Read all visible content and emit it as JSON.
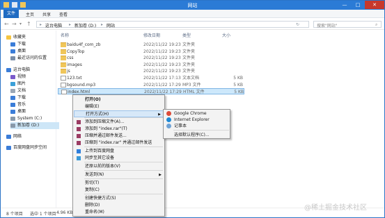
{
  "window": {
    "title": "网站"
  },
  "titlebar": {
    "minimize": "—",
    "maximize": "□",
    "close": "✕"
  },
  "ribbon": {
    "tabs": [
      "文件",
      "主页",
      "共享",
      "查看"
    ]
  },
  "address": {
    "crumbs": [
      "这台电脑",
      "新加卷 (D:)",
      "网站"
    ],
    "search_placeholder": "搜索\"网站\""
  },
  "sidebar": {
    "items": [
      {
        "label": "收藏夹",
        "icon": "star-icon",
        "color": "#f5c542"
      },
      {
        "label": "下载",
        "icon": "download-icon",
        "color": "#3b7dd8"
      },
      {
        "label": "桌面",
        "icon": "desktop-icon",
        "color": "#3b7dd8"
      },
      {
        "label": "最近访问的位置",
        "icon": "recent-icon",
        "color": "#7a8ea8"
      },
      {
        "label": "这台电脑",
        "icon": "computer-icon",
        "color": "#3b7dd8"
      },
      {
        "label": "视频",
        "icon": "video-icon",
        "color": "#7a5acb"
      },
      {
        "label": "图片",
        "icon": "picture-icon",
        "color": "#3ba0d8"
      },
      {
        "label": "文档",
        "icon": "document-icon",
        "color": "#9aa7b6"
      },
      {
        "label": "下载",
        "icon": "download-icon",
        "color": "#3b7dd8"
      },
      {
        "label": "音乐",
        "icon": "music-icon",
        "color": "#3b7dd8"
      },
      {
        "label": "桌面",
        "icon": "desktop-icon",
        "color": "#3b7dd8"
      },
      {
        "label": "System (C:)",
        "icon": "drive-icon",
        "color": "#8899aa"
      },
      {
        "label": "新加卷 (D:)",
        "icon": "drive-icon",
        "color": "#8899aa"
      },
      {
        "label": "网络",
        "icon": "network-icon",
        "color": "#3b7dd8"
      },
      {
        "label": "百度网盘同步空间",
        "icon": "cloud-icon",
        "color": "#3b7dd8"
      }
    ]
  },
  "columns": {
    "name": "名称",
    "date": "修改日期",
    "type": "类型",
    "size": "大小"
  },
  "files": [
    {
      "name": "baidu4f_com_zb",
      "date": "2022/11/22 19:23",
      "type": "文件夹",
      "size": "",
      "kind": "folder"
    },
    {
      "name": "CopyTop",
      "date": "2022/11/22 19:23",
      "type": "文件夹",
      "size": "",
      "kind": "folder"
    },
    {
      "name": "css",
      "date": "2022/11/22 19:23",
      "type": "文件夹",
      "size": "",
      "kind": "folder"
    },
    {
      "name": "images",
      "date": "2022/11/22 19:23",
      "type": "文件夹",
      "size": "",
      "kind": "folder"
    },
    {
      "name": "js",
      "date": "2022/11/22 19:23",
      "type": "文件夹",
      "size": "",
      "kind": "folder"
    },
    {
      "name": "123.txt",
      "date": "2022/11/22 17:13",
      "type": "文本文档",
      "size": "5 KB",
      "kind": "file"
    },
    {
      "name": "bgsound.mp3",
      "date": "2022/11/22 17:29",
      "type": "MP3 文件",
      "size": "5 KB",
      "kind": "file"
    },
    {
      "name": "index.html",
      "date": "2022/11/22 17:29",
      "type": "HTML 文件",
      "size": "5 KB",
      "kind": "file"
    }
  ],
  "status": {
    "count": "8 个项目",
    "selected": "选中 1 个项目",
    "size": "4.96 KB"
  },
  "context_menu": {
    "items": [
      {
        "label": "打开(O)",
        "bold": true
      },
      {
        "label": "编辑(E)"
      },
      {
        "label": "打开方式(H)",
        "submenu": true,
        "highlight": true
      },
      {
        "label": "添加到压缩文件(A)...",
        "icon": "winrar-icon"
      },
      {
        "label": "添加到 \"index.rar\"(T)",
        "icon": "winrar-icon"
      },
      {
        "label": "压缩并通过邮件发送...",
        "icon": "winrar-icon"
      },
      {
        "label": "压缩到 \"index.rar\" 并通过邮件发送",
        "icon": "winrar-icon"
      },
      {
        "label": "上传到百度网盘",
        "icon": "cloud-icon"
      },
      {
        "label": "同步至其它设备",
        "icon": "sync-icon"
      },
      {
        "label": "还原以前的版本(V)"
      },
      {
        "label": "发送到(N)",
        "submenu": true
      },
      {
        "label": "剪切(T)"
      },
      {
        "label": "复制(C)"
      },
      {
        "label": "创建快捷方式(S)"
      },
      {
        "label": "删除(D)"
      },
      {
        "label": "重命名(M)"
      }
    ]
  },
  "submenu": {
    "items": [
      {
        "label": "Google Chrome",
        "icon": "chrome-icon",
        "color": "#dd4b39"
      },
      {
        "label": "Internet Explorer",
        "icon": "ie-icon",
        "color": "#1e8ad6"
      },
      {
        "label": "记事本",
        "icon": "notepad-icon",
        "color": "#6fa3d6"
      },
      {
        "label": "选择默认程序(C)..."
      }
    ]
  },
  "watermark": "@稀土掘金技术社区"
}
